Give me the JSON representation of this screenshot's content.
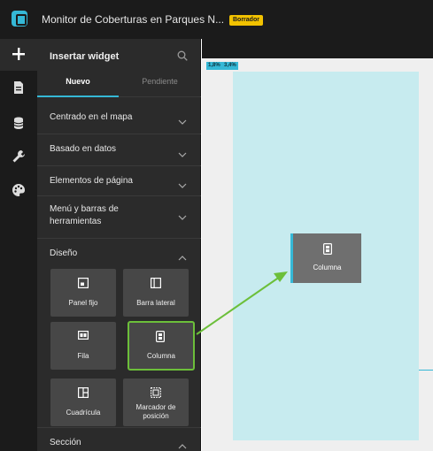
{
  "header": {
    "app_title": "Monitor de Coberturas en Parques N...",
    "status_badge": "Borrador"
  },
  "rail": {
    "icons": [
      "plus-icon",
      "page-icon",
      "data-icon",
      "tool-icon",
      "palette-icon"
    ]
  },
  "panel": {
    "title": "Insertar widget",
    "tabs": [
      {
        "label": "Nuevo"
      },
      {
        "label": "Pendiente"
      }
    ],
    "sections": [
      {
        "label": "Centrado en el mapa"
      },
      {
        "label": "Basado en datos"
      },
      {
        "label": "Elementos de página"
      },
      {
        "label": "Menú y barras de herramientas"
      },
      {
        "label": "Diseño"
      },
      {
        "label": "Sección"
      }
    ],
    "tiles": [
      {
        "label": "Panel fijo"
      },
      {
        "label": "Barra lateral"
      },
      {
        "label": "Fila"
      },
      {
        "label": "Columna"
      },
      {
        "label": "Cuadrícula"
      },
      {
        "label": "Marcador de posición"
      }
    ]
  },
  "canvas": {
    "ruler_tags": [
      "1,8%",
      "3,4%"
    ],
    "dropped_widget_label": "Columna"
  },
  "colors": {
    "accent": "#35b8d6",
    "highlight": "#6cbf3a",
    "badge": "#f2c200",
    "page_bg": "#c7ebef"
  }
}
